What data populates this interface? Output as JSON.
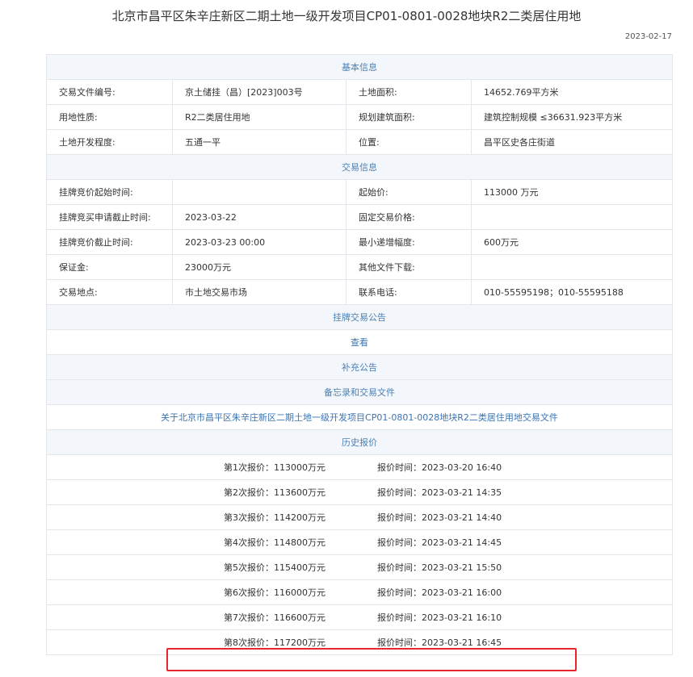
{
  "title": "北京市昌平区朱辛庄新区二期土地一级开发项目CP01-0801-0028地块R2二类居住用地",
  "date": "2023-02-17",
  "basic_info": {
    "header": "基本信息",
    "rows": [
      {
        "label1": "交易文件编号:",
        "value1": "京土储挂（昌）[2023]003号",
        "label2": "土地面积:",
        "value2": "14652.769平方米"
      },
      {
        "label1": "用地性质:",
        "value1": "R2二类居住用地",
        "label2": "规划建筑面积:",
        "value2": "建筑控制规模 ≤36631.923平方米"
      },
      {
        "label1": "土地开发程度:",
        "value1": "五通一平",
        "label2": "位置:",
        "value2": "昌平区史各庄街道"
      }
    ]
  },
  "trade_info": {
    "header": "交易信息",
    "rows": [
      {
        "label1": "挂牌竞价起始时间:",
        "value1": "",
        "label2": "起始价:",
        "value2": "113000 万元"
      },
      {
        "label1": "挂牌竞买申请截止时间:",
        "value1": "2023-03-22",
        "label2": "固定交易价格:",
        "value2": ""
      },
      {
        "label1": "挂牌竞价截止时间:",
        "value1": "2023-03-23 00:00",
        "label2": "最小递增幅度:",
        "value2": "600万元"
      },
      {
        "label1": "保证金:",
        "value1": "23000万元",
        "label2": "其他文件下载:",
        "value2": ""
      },
      {
        "label1": "交易地点:",
        "value1": "市土地交易市场",
        "label2": "联系电话:",
        "value2": "010-55595198；010-55595188"
      }
    ]
  },
  "announcement": {
    "header": "挂牌交易公告",
    "view_link": "查看"
  },
  "supplement": {
    "header": "补充公告"
  },
  "memo": {
    "header": "备忘录和交易文件",
    "file_link": "关于北京市昌平区朱辛庄新区二期土地一级开发项目CP01-0801-0028地块R2二类居住用地交易文件"
  },
  "history": {
    "header": "历史报价",
    "bids": [
      {
        "amount": "第1次报价：113000万元",
        "time": "报价时间：2023-03-20 16:40"
      },
      {
        "amount": "第2次报价：113600万元",
        "time": "报价时间：2023-03-21 14:35"
      },
      {
        "amount": "第3次报价：114200万元",
        "time": "报价时间：2023-03-21 14:40"
      },
      {
        "amount": "第4次报价：114800万元",
        "time": "报价时间：2023-03-21 14:45"
      },
      {
        "amount": "第5次报价：115400万元",
        "time": "报价时间：2023-03-21 15:50"
      },
      {
        "amount": "第6次报价：116000万元",
        "time": "报价时间：2023-03-21 16:00"
      },
      {
        "amount": "第7次报价：116600万元",
        "time": "报价时间：2023-03-21 16:10"
      },
      {
        "amount": "第8次报价：117200万元",
        "time": "报价时间：2023-03-21 16:45"
      }
    ]
  },
  "colors": {
    "section_bg": "#f3f7fb",
    "section_text": "#4c7fb4",
    "link": "#3a74b3",
    "highlight_border": "#e8262d",
    "border": "#e3e6ea"
  }
}
